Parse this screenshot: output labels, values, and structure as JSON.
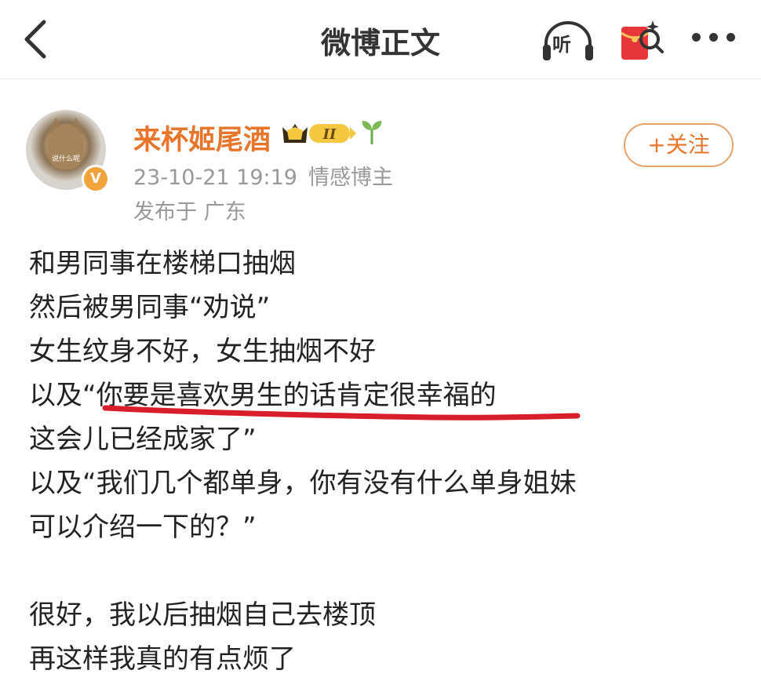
{
  "header": {
    "title": "微博正文",
    "listen_label": "听"
  },
  "post": {
    "author": {
      "name": "来杯姬尾酒",
      "avatar_caption": "说什么呢",
      "verified_badge": "V",
      "vip_level": "II"
    },
    "time": "23-10-21 19:19",
    "category": "情感博主",
    "location": "发布于 广东",
    "follow_label": "+关注",
    "lines": [
      "和男同事在楼梯口抽烟",
      "然后被男同事“劝说”",
      "女生纹身不好，女生抽烟不好",
      "以及“你要是喜欢男生的话肯定很幸福的",
      "这会儿已经成家了”",
      "以及“我们几个都单身，你有没有什么单身姐妹",
      "可以介绍一下的？”",
      "",
      "很好，我以后抽烟自己去楼顶",
      "再这样我真的有点烦了"
    ]
  },
  "colors": {
    "accent_orange": "#e8752a",
    "underline_red": "#d81e2a",
    "meta_gray": "#999999"
  },
  "icons": [
    "back-arrow-icon",
    "listen-icon",
    "red-packet-icon",
    "more-icon",
    "vip-crown-icon",
    "sprout-icon",
    "verified-icon"
  ]
}
